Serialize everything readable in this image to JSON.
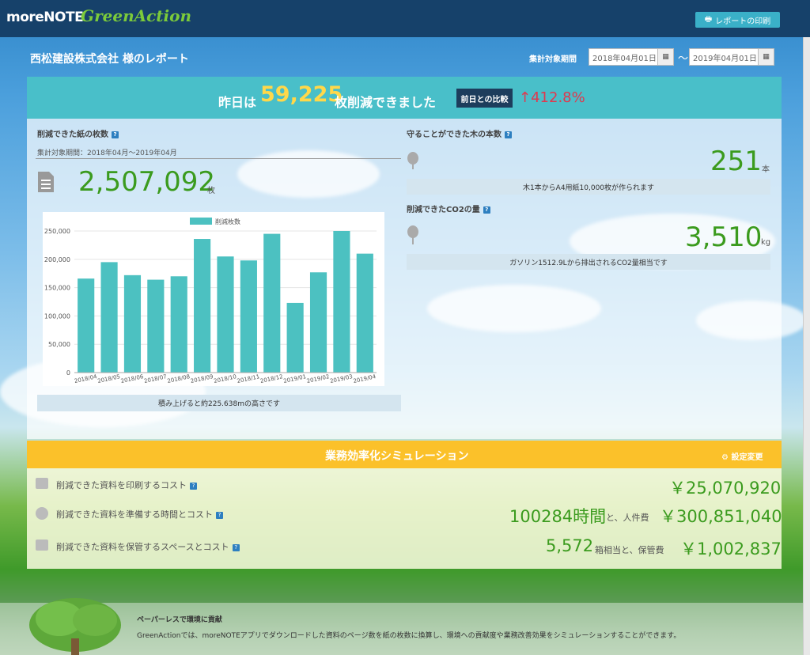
{
  "header": {
    "logo_main": "moreNOTE",
    "logo_sub": "GreenAction",
    "print_label": "レポートの印刷"
  },
  "report": {
    "title": "西松建設株式会社 様のレポート",
    "period_label": "集計対象期間",
    "date_from": "2018年04月01日",
    "date_to": "2019年04月01日",
    "tilde": "～"
  },
  "banner": {
    "prefix": "昨日は",
    "count": "59,225",
    "suffix": "枚削減できました",
    "compare_label": "前日との比較",
    "change": "↑412.8%"
  },
  "paper": {
    "heading": "削減できた紙の枚数",
    "period": "集計対象期間：2018年04月～2019年04月",
    "total": "2,507,092",
    "unit": "枚",
    "height_note": "積み上げると約225.638mの高さです"
  },
  "trees": {
    "heading": "守ることができた木の本数",
    "count": "251",
    "unit": "本",
    "note": "木1本からA4用紙10,000枚が作られます"
  },
  "co2": {
    "heading": "削減できたCO2の量",
    "amount": "3,510",
    "unit": "kg",
    "note": "ガソリン1512.9Lから排出されるCO2量相当です"
  },
  "chart_data": {
    "type": "bar",
    "legend": "削減枚数",
    "categories": [
      "2018/04",
      "2018/05",
      "2018/06",
      "2018/07",
      "2018/08",
      "2018/09",
      "2018/10",
      "2018/11",
      "2018/12",
      "2019/01",
      "2019/02",
      "2019/03",
      "2019/04"
    ],
    "values": [
      166000,
      195000,
      172000,
      164000,
      170000,
      236000,
      205000,
      198000,
      245000,
      123000,
      177000,
      250000,
      210000
    ],
    "ylim": [
      0,
      250000
    ],
    "yticks": [
      "0",
      "50,000",
      "100,000",
      "150,000",
      "200,000",
      "250,000"
    ],
    "color": "#4cc1c1",
    "grid": true,
    "legend_position": "top-center"
  },
  "simulation": {
    "title": "業務効率化シミュレーション",
    "settings": "設定変更",
    "print_label": "削減できた資料を印刷するコスト",
    "print_cost": "￥25,070,920",
    "prep_label": "削減できた資料を準備する時間とコスト",
    "prep_hours": "100284時間",
    "prep_mid": "と、人件費",
    "prep_cost": "￥300,851,040",
    "store_label": "削減できた資料を保管するスペースとコスト",
    "store_boxes": "5,572",
    "store_mid": "箱相当と、保管費",
    "store_cost": "￥1,002,837"
  },
  "footer": {
    "heading": "ペーパーレスで環境に貢献",
    "text": "GreenActionでは、moreNOTEアプリでダウンロードした資料のページ数を紙の枚数に換算し、環境への貢献度や業務改善効果をシミュレーションすることができます。"
  },
  "help_mark": "?"
}
